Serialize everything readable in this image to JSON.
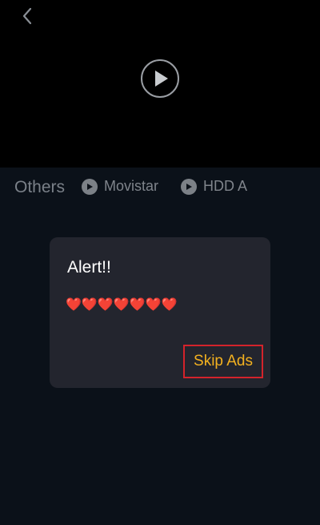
{
  "video": {
    "back_icon": "chevron-left-icon",
    "play_icon": "play-circle-icon"
  },
  "sources": {
    "label": "Others",
    "items": [
      {
        "label": "Movistar",
        "icon": "play-icon"
      },
      {
        "label": "HDD A",
        "icon": "play-icon"
      }
    ]
  },
  "dialog": {
    "title": "Alert!!",
    "message": "❤️❤️❤️❤️❤️❤️❤️",
    "skip_label": "Skip Ads"
  },
  "colors": {
    "background": "#0b1119",
    "video_background": "#000000",
    "dialog_background": "#23252e",
    "skip_text": "#f3b11f",
    "skip_border": "#d3232b",
    "muted_text": "#7f848b"
  }
}
